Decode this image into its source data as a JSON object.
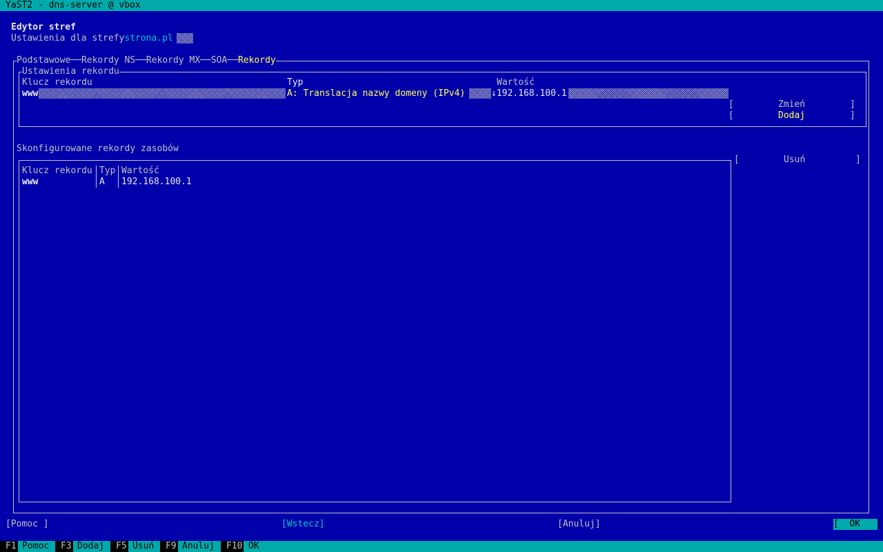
{
  "window": {
    "title": "YaST2 - dns-server @ vbox"
  },
  "header": {
    "title": "Edytor stref",
    "subtitle_prefix": "Ustawienia dla strefy",
    "zone": "strona.pl"
  },
  "tabs": [
    {
      "label": "Podstawowe"
    },
    {
      "label": "Rekordy NS"
    },
    {
      "label": "Rekordy MX"
    },
    {
      "label": "SOA"
    },
    {
      "label": "Rekordy"
    }
  ],
  "record_settings": {
    "title": "Ustawienia rekordu",
    "key_label": "Klucz rekordu",
    "key_value": "www",
    "type_label": "Typ",
    "type_value": "A: Translacja nazwy domeny (IPv4)",
    "value_label": "Wartość",
    "value_value": "↓192.168.100.1",
    "change_button": "Zmień",
    "add_button": "Dodaj"
  },
  "records_table": {
    "title": "Skonfigurowane rekordy zasobów",
    "columns": [
      "Klucz rekordu",
      "Typ",
      "Wartość"
    ],
    "rows": [
      {
        "key": "www",
        "type": "A",
        "value": "192.168.100.1"
      }
    ],
    "delete_button": "Usuń"
  },
  "bottom_buttons": {
    "help": "Pomoc",
    "back": "Wstecz",
    "cancel": "Anuluj",
    "ok": "OK"
  },
  "function_keys": [
    {
      "key": "F1",
      "label": "Pomoc"
    },
    {
      "key": "F3",
      "label": "Dodaj"
    },
    {
      "key": "F5",
      "label": "Usuń"
    },
    {
      "key": "F9",
      "label": "Anuluj"
    },
    {
      "key": "F10",
      "label": "OK"
    }
  ]
}
